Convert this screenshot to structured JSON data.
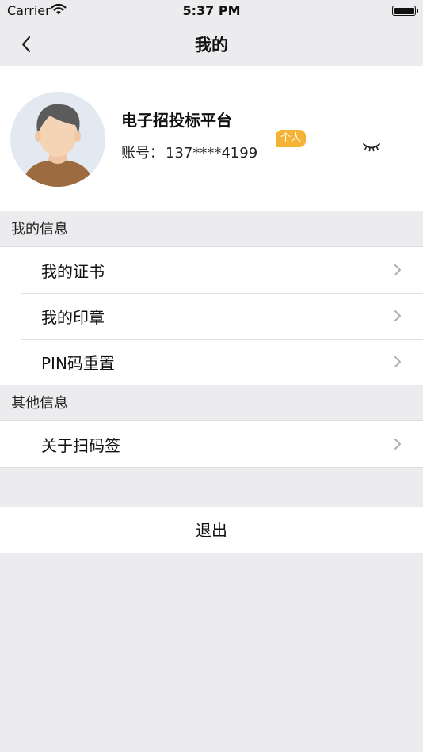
{
  "status_bar": {
    "carrier": "Carrier",
    "time": "5:37 PM"
  },
  "nav": {
    "title": "我的",
    "back_icon": "chevron-left-icon"
  },
  "profile": {
    "name": "电子招投标平台",
    "account_label": "账号：",
    "account_value": "137****4199",
    "badge": "个人",
    "badge_color": "#f5b335",
    "visibility_icon": "eye-closed-icon"
  },
  "sections": [
    {
      "header": "我的信息",
      "items": [
        {
          "label": "我的证书"
        },
        {
          "label": "我的印章"
        },
        {
          "label": "PIN码重置"
        }
      ]
    },
    {
      "header": "其他信息",
      "items": [
        {
          "label": "关于扫码签"
        }
      ]
    }
  ],
  "logout_label": "退出"
}
